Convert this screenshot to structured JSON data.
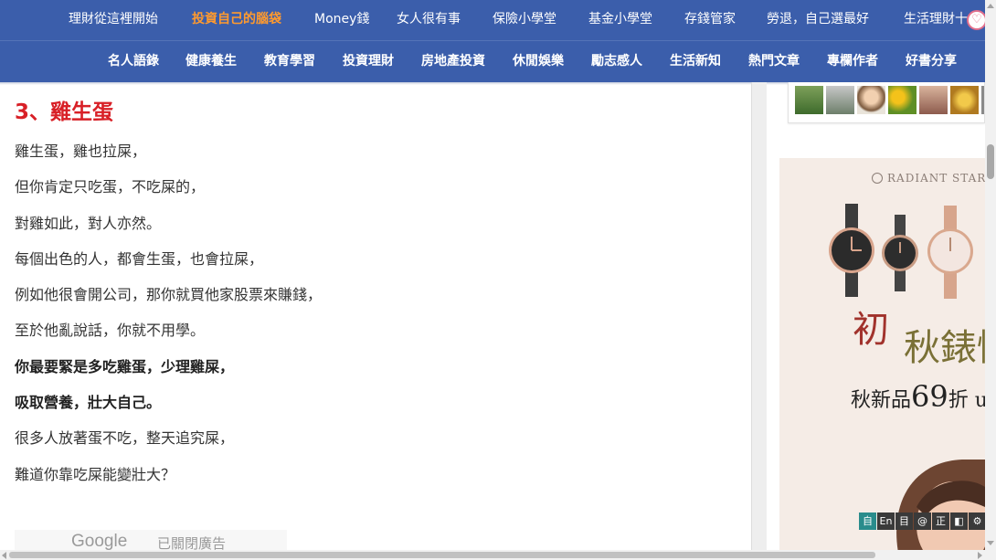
{
  "nav_primary": [
    {
      "label": "理財從這裡開始",
      "active": false
    },
    {
      "label": "投資自己的腦袋",
      "active": true
    },
    {
      "label": "Money錢",
      "active": false
    },
    {
      "label": "女人很有事",
      "active": false
    },
    {
      "label": "保險小學堂",
      "active": false
    },
    {
      "label": "基金小學堂",
      "active": false
    },
    {
      "label": "存錢管家",
      "active": false
    },
    {
      "label": "勞退，自己選最好",
      "active": false
    },
    {
      "label": "生活理財十",
      "active": false
    }
  ],
  "nav_secondary": [
    {
      "label": "名人語錄"
    },
    {
      "label": "健康養生"
    },
    {
      "label": "教育學習"
    },
    {
      "label": "投資理財"
    },
    {
      "label": "房地產投資"
    },
    {
      "label": "休閒娛樂"
    },
    {
      "label": "勵志感人"
    },
    {
      "label": "生活新知"
    },
    {
      "label": "熱門文章"
    },
    {
      "label": "專欄作者"
    },
    {
      "label": "好書分享"
    }
  ],
  "favorite_icon": "heart-icon",
  "article": {
    "heading": "3、雞生蛋",
    "lines": [
      {
        "text": "雞生蛋，雞也拉屎，",
        "bold": false
      },
      {
        "text": "但你肯定只吃蛋，不吃屎的，",
        "bold": false
      },
      {
        "text": "對雞如此，對人亦然。",
        "bold": false
      },
      {
        "text": "每個出色的人，都會生蛋，也會拉屎，",
        "bold": false
      },
      {
        "text": "例如他很會開公司，那你就買他家股票來賺錢，",
        "bold": false
      },
      {
        "text": "至於他亂說話，你就不用學。",
        "bold": false
      },
      {
        "text": "你最要緊是多吃雞蛋，少理雞屎，",
        "bold": true
      },
      {
        "text": "吸取營養，壯大自己。",
        "bold": true
      },
      {
        "text": "很多人放著蛋不吃，整天追究屎，",
        "bold": false
      },
      {
        "text": "難道你靠吃屎能變壯大？",
        "bold": false
      }
    ]
  },
  "google_ad": {
    "logo": "Google",
    "label": "已關閉廣告"
  },
  "sidebar": {
    "avatars": [
      "tree-photo",
      "person-photo",
      "woman-photo",
      "sunflower-photo",
      "group-photo",
      "flower-photo",
      "partial-photo"
    ],
    "ad": {
      "brand": "RADIANT STAR",
      "title_char1": "初",
      "title_rest": "秋錶情",
      "sub_prefix": "秋新品",
      "sub_number": "69",
      "sub_suffix": "折 u"
    }
  },
  "toolbar": [
    {
      "label": "自",
      "active": true,
      "icon": "auto-icon"
    },
    {
      "label": "En",
      "active": false,
      "icon": "english-icon"
    },
    {
      "label": "目",
      "active": false,
      "icon": "page-icon"
    },
    {
      "label": "@",
      "active": false,
      "icon": "at-icon"
    },
    {
      "label": "正",
      "active": false,
      "icon": "traditional-icon"
    },
    {
      "label": "◧",
      "active": false,
      "icon": "contrast-icon"
    },
    {
      "label": "⚙",
      "active": false,
      "icon": "gear-icon"
    }
  ],
  "colors": {
    "nav_bg": "#3b5eab",
    "nav_active": "#ff9a2e",
    "heading": "#d82027",
    "ad_bg": "#f5ece6"
  }
}
